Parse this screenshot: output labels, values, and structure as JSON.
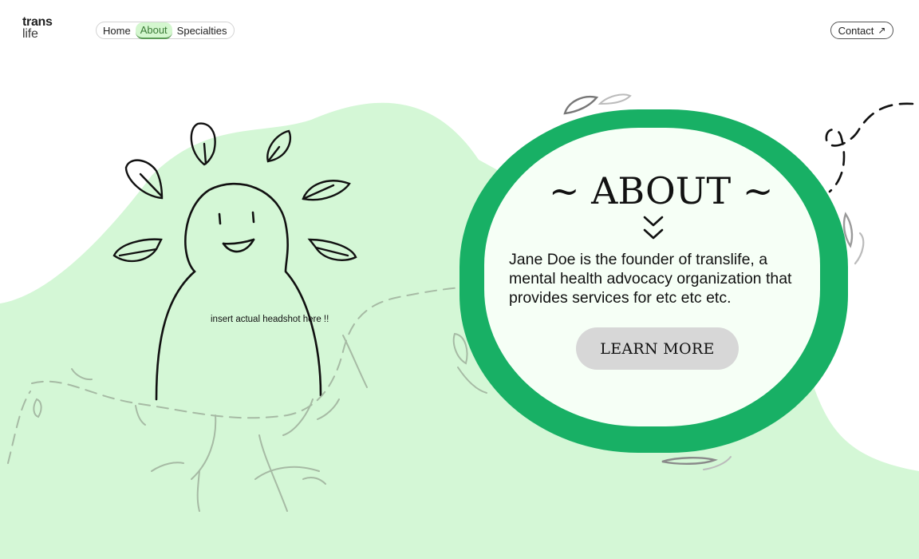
{
  "logo": {
    "line1": "trans",
    "line2": "life"
  },
  "nav": {
    "items": [
      {
        "label": "Home",
        "active": false
      },
      {
        "label": "About",
        "active": true
      },
      {
        "label": "Specialties",
        "active": false
      }
    ]
  },
  "contact": {
    "label": "Contact",
    "icon": "arrow-up-right-icon",
    "arrow_glyph": "↗"
  },
  "hero": {
    "headshot_note": "insert actual headshot here !!"
  },
  "about": {
    "title": "~ ABOUT ~",
    "description": "Jane Doe is the founder of translife, a mental health advocacy organization that provides services for etc etc etc.",
    "cta_label": "LEARN MORE"
  },
  "colors": {
    "background_blob": "#d4f7d6",
    "ring": "#18b065",
    "inner": "#f6fff6",
    "active_tab": "#d4f7cf",
    "button": "#d7d7d7"
  }
}
